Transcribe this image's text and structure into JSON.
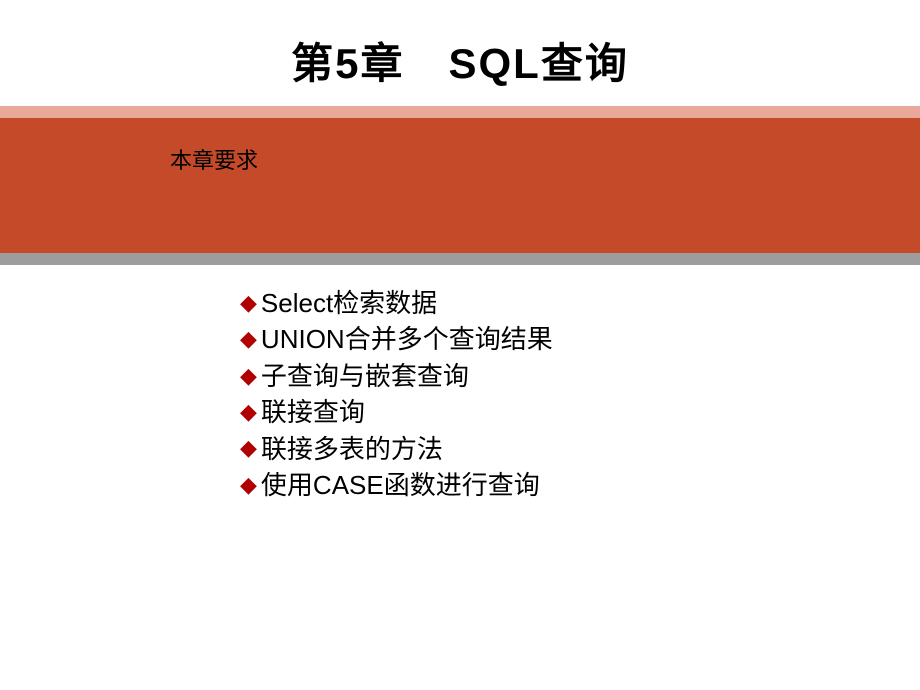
{
  "title": {
    "chapter_prefix": "第",
    "chapter_number": "5",
    "chapter_suffix": "章",
    "chapter_topic": "SQL查询",
    "full_title": "第5章　SQL查询"
  },
  "band": {
    "label": "本章要求"
  },
  "bullets": {
    "marker": "◆",
    "items": [
      "Select检索数据",
      "UNION合并多个查询结果",
      "子查询与嵌套查询",
      "联接查询",
      "联接多表的方法",
      "使用CASE函数进行查询"
    ]
  },
  "colors": {
    "orange_band": "#c44a2a",
    "pink_band": "#e8a89a",
    "gray_band": "#9d9d9d",
    "bullet_marker": "#b00000"
  }
}
